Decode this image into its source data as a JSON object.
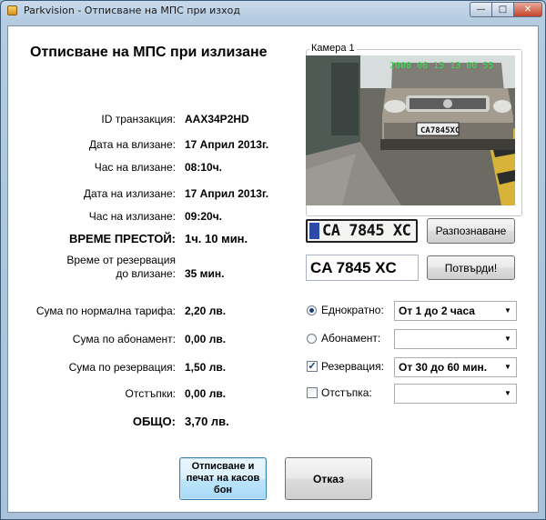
{
  "window": {
    "title": "Parkvision - Отписване на МПС при изход",
    "controls": {
      "minimize": "—",
      "maximize": "□",
      "close": "✕"
    }
  },
  "heading": "Отписване на МПС при излизане",
  "camera": {
    "label": "Камера 1",
    "timestamp": "2008 06 15 13 00 55",
    "car_plate": "CA7845XC"
  },
  "details": [
    {
      "label": "ID транзакция:",
      "value": "AAX34P2HD"
    },
    {
      "label": "Дата на влизане:",
      "value": "17 Април 2013г."
    },
    {
      "label": "Час на влизане:",
      "value": "08:10ч."
    },
    {
      "label": "Дата на излизане:",
      "value": "17 Април 2013г."
    },
    {
      "label": "Час на излизане:",
      "value": "09:20ч."
    },
    {
      "label": "ВРЕМЕ ПРЕСТОЙ:",
      "value": "1ч. 10 мин."
    },
    {
      "label_line1": "Време от резервация",
      "label_line2": "до влизане:",
      "value": "35 мин."
    }
  ],
  "plate": {
    "recognized_image_text": "CA 7845 XC",
    "text": "CA 7845 XC"
  },
  "buttons": {
    "recognize": "Разпознаване",
    "confirm": "Потвърди!",
    "print": "Отписване и печат на касов бон",
    "cancel": "Отказ"
  },
  "amounts": [
    {
      "label": "Сума по нормална тарифа:",
      "value": "2,20 лв."
    },
    {
      "label": "Сума по абонамент:",
      "value": "0,00 лв."
    },
    {
      "label": "Сума по резервация:",
      "value": "1,50 лв."
    },
    {
      "label": "Отстъпки:",
      "value": "0,00 лв."
    },
    {
      "label": "ОБЩО:",
      "value": "3,70 лв."
    }
  ],
  "options": [
    {
      "label": "Еднократно:",
      "type": "radio",
      "checked": true,
      "selected": "От 1 до 2 часа"
    },
    {
      "label": "Абонамент:",
      "type": "radio",
      "checked": false,
      "selected": ""
    },
    {
      "label": "Резервация:",
      "type": "checkbox",
      "checked": true,
      "selected": "От 30 до 60 мин."
    },
    {
      "label": "Отстъпка:",
      "type": "checkbox",
      "checked": false,
      "selected": ""
    }
  ],
  "icons": {
    "combo_arrow": "▼",
    "check": "✓"
  }
}
